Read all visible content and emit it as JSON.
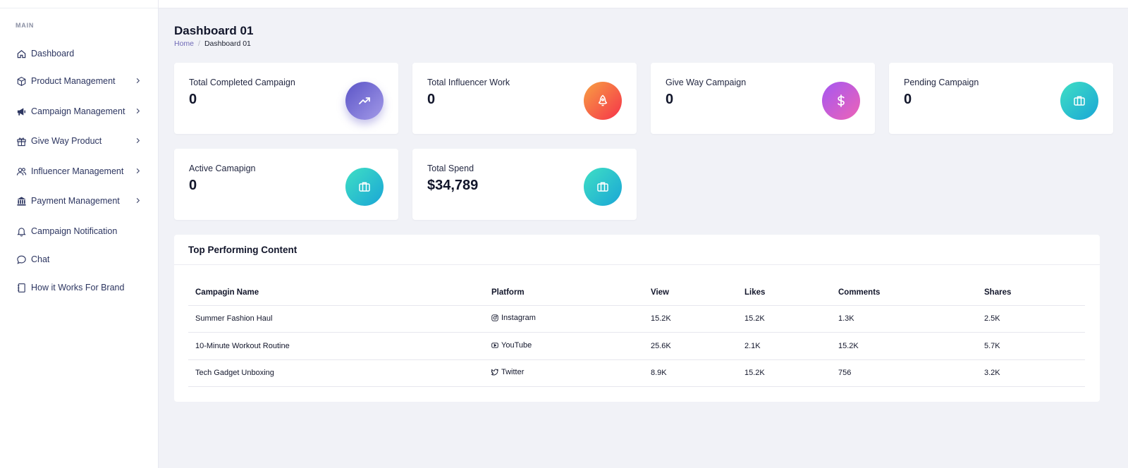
{
  "sidebar": {
    "section_label": "MAIN",
    "items": [
      {
        "label": "Dashboard",
        "icon": "home-icon"
      },
      {
        "label": "Product Management",
        "icon": "cube-icon",
        "has_children": true
      },
      {
        "label": "Campaign Management",
        "icon": "megaphone-icon",
        "has_children": true
      },
      {
        "label": "Give Way Product",
        "icon": "gift-icon",
        "has_children": true
      },
      {
        "label": "Influencer Management",
        "icon": "users-icon",
        "has_children": true
      },
      {
        "label": "Payment Management",
        "icon": "bank-icon",
        "has_children": true
      },
      {
        "label": "Campaign Notification",
        "icon": "bell-icon"
      },
      {
        "label": "Chat",
        "icon": "chat-bubble-icon"
      },
      {
        "label": "How it Works For Brand",
        "icon": "notebook-icon"
      }
    ]
  },
  "header": {
    "title": "Dashboard 01",
    "breadcrumb": {
      "home": "Home",
      "separator": "/",
      "current": "Dashboard 01"
    }
  },
  "cards": [
    {
      "label": "Total Completed Campaign",
      "value": "0",
      "icon": "trending-up-icon",
      "gradient": [
        "#5b54c7",
        "#a39ae8"
      ]
    },
    {
      "label": "Total Influencer Work",
      "value": "0",
      "icon": "rocket-icon",
      "gradient": [
        "#f7a043",
        "#f6324a"
      ]
    },
    {
      "label": "Give Way Campaign",
      "value": "0",
      "icon": "dollar-icon",
      "gradient": [
        "#a457f2",
        "#ee63b6"
      ]
    },
    {
      "label": "Pending Campaign",
      "value": "0",
      "icon": "briefcase-icon",
      "gradient": [
        "#3fdfc4",
        "#1aa6d6"
      ]
    },
    {
      "label": "Active Camapign",
      "value": "0",
      "icon": "briefcase-icon",
      "gradient": [
        "#3fdfc4",
        "#1aa6d6"
      ]
    },
    {
      "label": "Total Spend",
      "value": "$34,789",
      "icon": "briefcase-icon",
      "gradient": [
        "#3fdfc4",
        "#1aa6d6"
      ]
    }
  ],
  "top_content": {
    "title": "Top Performing Content",
    "columns": [
      "Campagin Name",
      "Platform",
      "View",
      "Likes",
      "Comments",
      "Shares"
    ],
    "rows": [
      {
        "name": "Summer Fashion Haul",
        "platform": "Instagram",
        "platform_icon": "instagram-icon",
        "view": "15.2K",
        "likes": "15.2K",
        "comments": "1.3K",
        "shares": "2.5K"
      },
      {
        "name": "10-Minute Workout Routine",
        "platform": "YouTube",
        "platform_icon": "youtube-icon",
        "view": "25.6K",
        "likes": "2.1K",
        "comments": "15.2K",
        "shares": "5.7K"
      },
      {
        "name": "Tech Gadget Unboxing",
        "platform": "Twitter",
        "platform_icon": "twitter-icon",
        "view": "8.9K",
        "likes": "15.2K",
        "comments": "756",
        "shares": "3.2K"
      }
    ]
  },
  "colors": {
    "accent": "#6f6ab7",
    "nav_text": "#2c3560",
    "background": "#f1f2f7"
  }
}
